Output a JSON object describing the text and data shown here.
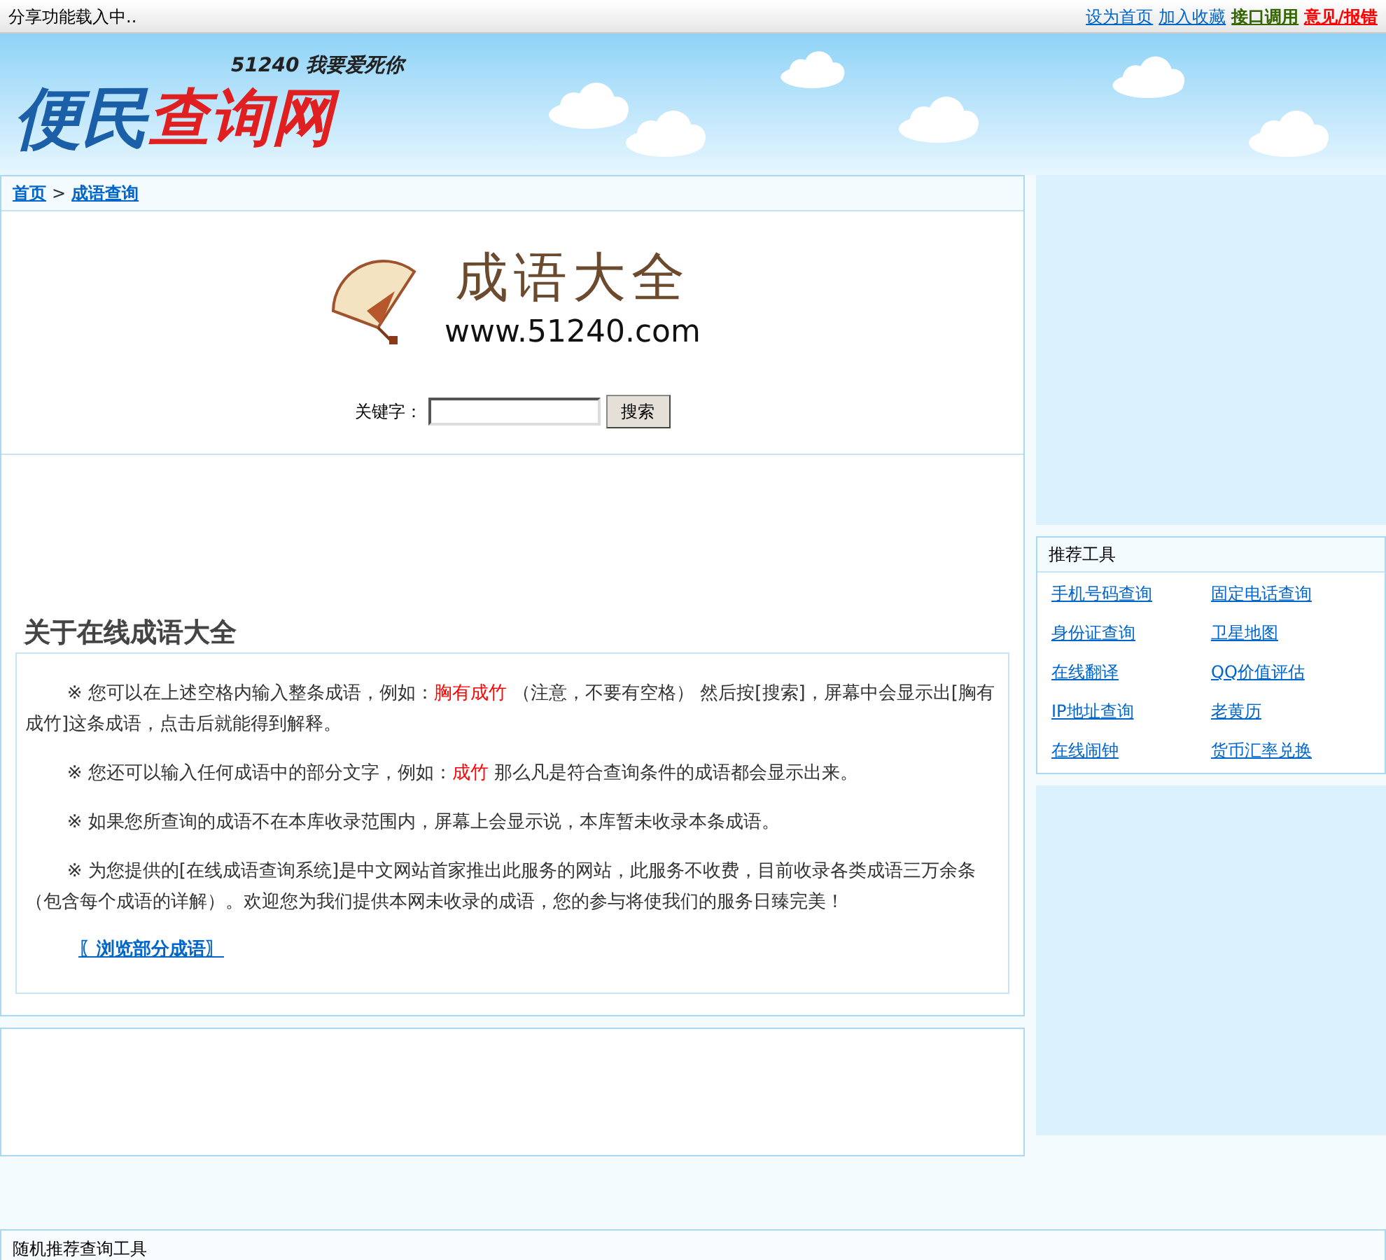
{
  "top_bar": {
    "status": "分享功能载入中..",
    "links": [
      {
        "label": "设为首页",
        "color": "#0066cc"
      },
      {
        "label": "加入收藏",
        "color": "#0066cc"
      },
      {
        "label": "接口调用",
        "color": "#336600"
      },
      {
        "label": "意见/报错",
        "color": "#ff0000"
      }
    ]
  },
  "logo": {
    "main": "便民",
    "accent": "查询网",
    "slogan": "51240 我要爱死你"
  },
  "breadcrumb": [
    {
      "label": "首页"
    },
    {
      "label": "成语查询"
    }
  ],
  "breadcrumb_separator": ">",
  "banner": {
    "title": "成语大全",
    "url": "www.51240.com"
  },
  "search": {
    "label": "关键字：",
    "button": "搜索"
  },
  "about": {
    "heading": "关于在线成语大全",
    "paragraphs": [
      [
        {
          "text": "※ 您可以在上述空格内输入整条成语，例如：",
          "highlight": false
        },
        {
          "text": "胸有成竹",
          "highlight": true
        },
        {
          "text": " （注意，不要有空格） 然后按[搜索]，屏幕中会显示出[胸有成竹]这条成语，点击后就能得到解释。",
          "highlight": false
        }
      ],
      [
        {
          "text": "※ 您还可以输入任何成语中的部分文字，例如：",
          "highlight": false
        },
        {
          "text": "成竹",
          "highlight": true
        },
        {
          "text": " 那么凡是符合查询条件的成语都会显示出来。",
          "highlight": false
        }
      ],
      [
        {
          "text": "※ 如果您所查询的成语不在本库收录范围内，屏幕上会显示说，本库暂未收录本条成语。",
          "highlight": false
        }
      ],
      [
        {
          "text": "※ 为您提供的[在线成语查询系统]是中文网站首家推出此服务的网站，此服务不收费，目前收录各类成语三万余条（包含每个成语的详解）。欢迎您为我们提供本网未收录的成语，您的参与将使我们的服务日臻完美！",
          "highlight": false
        }
      ]
    ],
    "browse_link": "〖浏览部分成语〗"
  },
  "tools": {
    "title": "推荐工具",
    "items": [
      "手机号码查询",
      "固定电话查询",
      "身份证查询",
      "卫星地图",
      "在线翻译",
      "QQ价值评估",
      "IP地址查询",
      "老黄历",
      "在线闹钟",
      "货币汇率兑换"
    ]
  },
  "footer_box": {
    "title": "随机推荐查询工具"
  }
}
